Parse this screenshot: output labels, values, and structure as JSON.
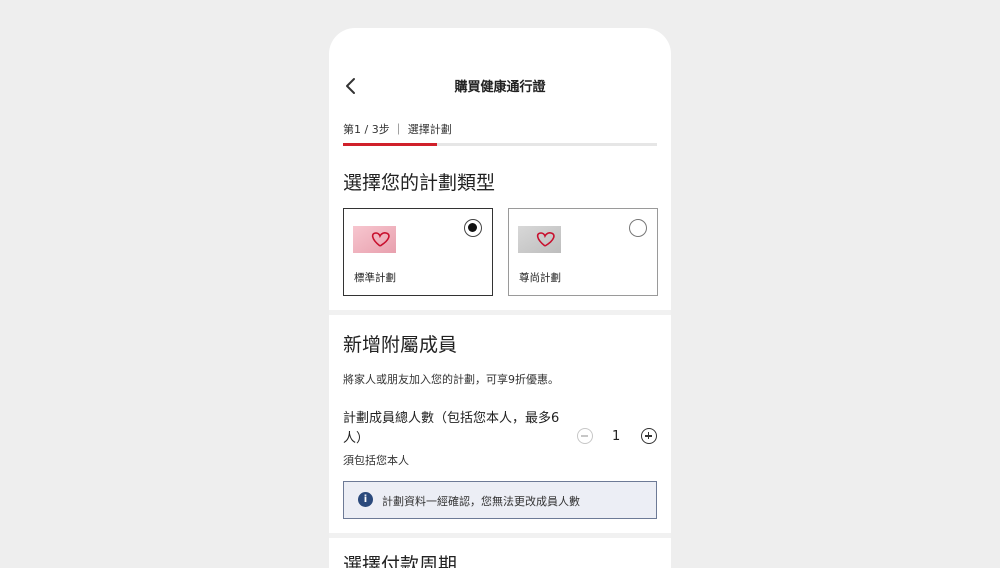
{
  "header": {
    "title": "購買健康通行證",
    "back_icon": "chevron-left-icon"
  },
  "steps": {
    "label": "第1 / 3步 ｜ 選擇計劃",
    "current": 1,
    "total": 3,
    "progress_fraction": 0.3
  },
  "plan_section": {
    "heading": "選擇您的計劃類型",
    "plans": [
      {
        "name": "標準計劃",
        "selected": true,
        "image_icon": "heart-card-pink-icon"
      },
      {
        "name": "尊尚計劃",
        "selected": false,
        "image_icon": "heart-card-grey-icon"
      }
    ]
  },
  "members_section": {
    "heading": "新增附屬成員",
    "description": "將家人或朋友加入您的計劃，可享9折優惠。",
    "count_label": "計劃成員總人數（包括您本人，最多6人）",
    "count_note": "須包括您本人",
    "count_value": "1",
    "info_text": "計劃資料一經確認，您無法更改成員人數",
    "info_icon_glyph": "i"
  },
  "next_section": {
    "heading": "選擇付款周期"
  },
  "colors": {
    "accent": "#d0202a",
    "info_icon": "#2b4a7c",
    "info_bg": "#eceef5"
  }
}
